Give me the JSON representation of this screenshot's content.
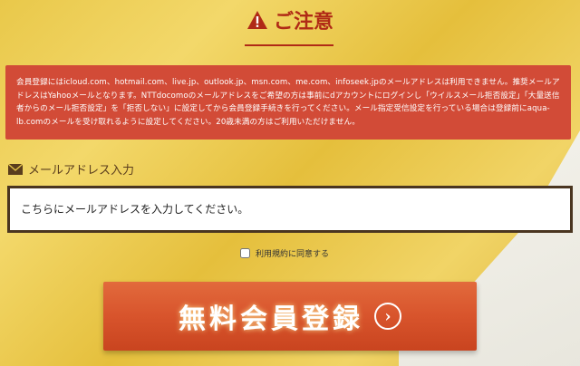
{
  "title": {
    "text": "ご注意",
    "icon": "warning-icon",
    "color": "#b02a16"
  },
  "notice": {
    "text": "会員登録にはicloud.com、hotmail.com、live.jp、outlook.jp、msn.com、me.com、infoseek.jpのメールアドレスは利用できません。推奨メールアドレスはYahooメールとなります。NTTdocomoのメールアドレスをご希望の方は事前にdアカウントにログインし「ウイルスメール拒否設定」「大量送信者からのメール拒否設定」を「拒否しない」に設定してから会員登録手続きを行ってください。メール指定受信設定を行っている場合は登録前にaqua-lb.comのメールを受け取れるように設定してください。20歳未満の方はご利用いただけません。",
    "background": "#d24b37"
  },
  "email": {
    "label": "メールアドレス入力",
    "icon": "envelope-icon",
    "placeholder": "こちらにメールアドレスを入力してください。"
  },
  "agree": {
    "label": "利用規約に同意する"
  },
  "register_button": {
    "label": "無料会員登録",
    "icon": "arrow-right-circle-icon",
    "color": "#d8542c"
  }
}
